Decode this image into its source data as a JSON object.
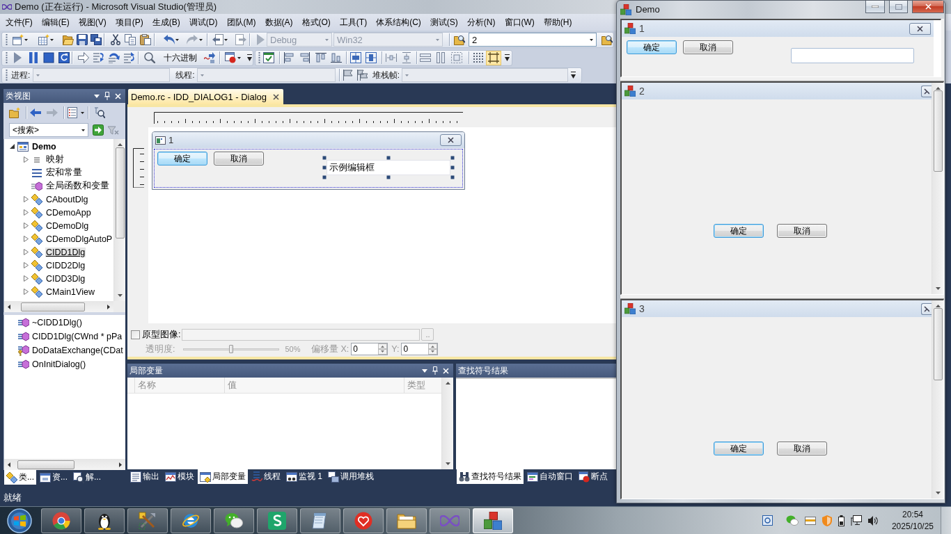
{
  "vs_window": {
    "title": "Demo (正在运行) - Microsoft Visual Studio(管理员)"
  },
  "menu_bar": [
    "文件(F)",
    "编辑(E)",
    "视图(V)",
    "项目(P)",
    "生成(B)",
    "调试(D)",
    "团队(M)",
    "数据(A)",
    "格式(O)",
    "工具(T)",
    "体系结构(C)",
    "测试(S)",
    "分析(N)",
    "窗口(W)",
    "帮助(H)"
  ],
  "standard_toolbar": {
    "configuration": {
      "value": "Debug",
      "disabled": true
    },
    "platform": {
      "value": "Win32",
      "disabled": true
    },
    "find": {
      "value": "2",
      "disabled": false
    }
  },
  "debug_toolbar": {
    "hex_button": {
      "label": "十六进制",
      "on": false
    }
  },
  "dialog_toolbar": {
    "guides_button": {
      "on": true
    }
  },
  "debug_location_toolbar": {
    "process_label": "进程:",
    "process": {
      "disabled": true
    },
    "thread_label": "线程:",
    "thread": {
      "disabled": true
    },
    "stack_frame_label": "堆栈帧:",
    "stack_frame": {
      "disabled": true
    }
  },
  "class_view": {
    "title": "类视图",
    "search": {
      "value": "<搜索>"
    },
    "tree": [
      {
        "label": "Demo",
        "kind": "project",
        "expanded": true,
        "selected": false,
        "children": [
          {
            "label": "映射",
            "kind": "map",
            "expanded": false,
            "selected": false
          },
          {
            "label": "宏和常量",
            "kind": "macros",
            "selected": false
          },
          {
            "label": "全局函数和变量",
            "kind": "globals",
            "selected": false
          },
          {
            "label": "CAboutDlg",
            "kind": "class",
            "expanded": false,
            "selected": false
          },
          {
            "label": "CDemoApp",
            "kind": "class",
            "expanded": false,
            "selected": false
          },
          {
            "label": "CDemoDlg",
            "kind": "class",
            "expanded": false,
            "selected": false
          },
          {
            "label": "CDemoDlgAutoP",
            "kind": "class",
            "expanded": false,
            "selected": false
          },
          {
            "label": "CIDD1Dlg",
            "kind": "class",
            "expanded": false,
            "selected": true
          },
          {
            "label": "CIDD2Dlg",
            "kind": "class",
            "expanded": false,
            "selected": false
          },
          {
            "label": "CIDD3Dlg",
            "kind": "class",
            "expanded": false,
            "selected": false
          },
          {
            "label": "CMain1View",
            "kind": "class",
            "expanded": false,
            "selected": false
          }
        ]
      }
    ],
    "members": [
      {
        "label": "~CIDD1Dlg()",
        "kind": "public"
      },
      {
        "label": "CIDD1Dlg(CWnd * pPa",
        "kind": "public"
      },
      {
        "label": "DoDataExchange(CDat",
        "kind": "protected"
      },
      {
        "label": "OnInitDialog()",
        "kind": "public"
      }
    ],
    "tabs": [
      {
        "label": "类...",
        "selected": true
      },
      {
        "label": "资...",
        "selected": false
      },
      {
        "label": "解...",
        "selected": false
      }
    ]
  },
  "document_tabs": [
    {
      "label": "Demo.rc - IDD_DIALOG1 - Dialog",
      "selected": true
    }
  ],
  "dialog_editor": {
    "dialog": {
      "title": "1",
      "buttons": [
        {
          "label": "确定",
          "default": true,
          "focused": true
        },
        {
          "label": "取消",
          "default": false,
          "focused": false
        }
      ],
      "edit_box": {
        "value": "示例编辑框",
        "selected": true
      }
    },
    "prototype_image": {
      "label": "原型图像:",
      "checked": false,
      "browse_button": ".."
    },
    "transparency": {
      "label": "透明度:",
      "disabled": true,
      "level": 0.5,
      "reading": "50%"
    },
    "offset": {
      "label": "偏移量",
      "disabled": true,
      "x_label": "X:",
      "x_value": "0",
      "y_label": "Y:",
      "y_value": "0"
    }
  },
  "locals_panel": {
    "title": "局部变量",
    "columns": [
      "名称",
      "值",
      "类型"
    ],
    "tabs": [
      {
        "label": "输出",
        "selected": false
      },
      {
        "label": "模块",
        "selected": false
      },
      {
        "label": "局部变量",
        "selected": true
      },
      {
        "label": "线程",
        "selected": false
      },
      {
        "label": "监视 1",
        "selected": false
      },
      {
        "label": "调用堆栈",
        "selected": false
      }
    ]
  },
  "find_symbol_panel": {
    "title": "查找符号结果",
    "tabs": [
      {
        "label": "查找符号结果",
        "selected": true
      },
      {
        "label": "自动窗口",
        "selected": false
      },
      {
        "label": "断点",
        "selected": false
      }
    ]
  },
  "status_bar": {
    "text": "就绪"
  },
  "demo_window": {
    "title": "Demo",
    "panes": [
      {
        "title": "1",
        "kind": "form",
        "buttons": [
          {
            "label": "确定",
            "default": true,
            "focused": true
          },
          {
            "label": "取消",
            "default": false,
            "focused": false
          }
        ]
      },
      {
        "title": "2",
        "kind": "scrolled",
        "buttons": [
          {
            "label": "确定",
            "default": true,
            "focused": false
          },
          {
            "label": "取消",
            "default": false,
            "focused": false
          }
        ]
      },
      {
        "title": "3",
        "kind": "scrolled",
        "buttons": [
          {
            "label": "确定",
            "default": true,
            "focused": false
          },
          {
            "label": "取消",
            "default": false,
            "focused": false
          }
        ]
      }
    ]
  },
  "taskbar": {
    "apps": [
      {
        "selected": false
      },
      {
        "selected": false
      },
      {
        "selected": false
      },
      {
        "selected": false
      },
      {
        "selected": false
      },
      {
        "selected": false
      },
      {
        "selected": false
      },
      {
        "selected": false
      },
      {
        "selected": false
      },
      {
        "selected": false
      },
      {
        "selected": true
      }
    ],
    "clock": {
      "time": "20:54",
      "date": "2025/10/25"
    }
  }
}
